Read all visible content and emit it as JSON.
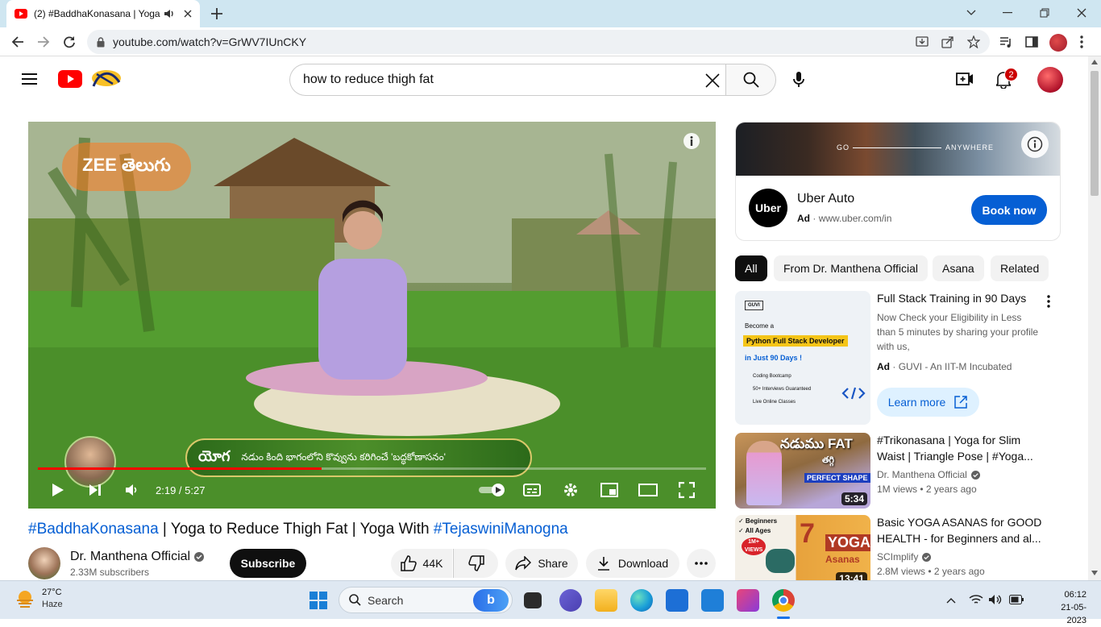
{
  "browser": {
    "tab_title": "(2) #BaddhaKonasana | Yoga",
    "url": "youtube.com/watch?v=GrWV7IUnCKY"
  },
  "youtube": {
    "search_query": "how to reduce thigh fat",
    "notification_count": "2"
  },
  "video": {
    "watermark": "ZEE తెలుగు",
    "caption_tag": "యోగ",
    "caption_text": "నడుం కింది భాగంలోని కొవ్వును కరిగించే 'బద్ధకోణాసనం'",
    "time": "2:19 / 5:27",
    "progress": 0.425,
    "title_prefix": "#BaddhaKonasana",
    "title_middle": " | Yoga to Reduce Thigh Fat | Yoga With ",
    "title_suffix": "#TejaswiniManogna",
    "channel_name": "Dr. Manthena Official",
    "subscribers": "2.33M subscribers",
    "subscribe_label": "Subscribe",
    "likes": "44K",
    "share_label": "Share",
    "download_label": "Download"
  },
  "ad_banner": {
    "overlay_left": "GO",
    "overlay_right": "ANYWHERE",
    "logo_text": "Uber",
    "title": "Uber Auto",
    "ad_label": "Ad",
    "url": "www.uber.com/in",
    "cta": "Book now"
  },
  "chips": [
    "All",
    "From Dr. Manthena Official",
    "Asana",
    "Related"
  ],
  "sidebar_ad": {
    "title": "Full Stack Training in 90 Days",
    "desc": "Now Check your Eligibility in Less than 5 minutes by sharing your profile with us,",
    "ad_label": "Ad",
    "advertiser": "GUVI - An IIT-M Incubated",
    "cta": "Learn more",
    "thumb": {
      "brand": "GUVI",
      "line1": "Become a",
      "highlight": "Python Full Stack Developer",
      "line2": "in Just 90 Days !",
      "bullets": [
        "Coding Bootcamp",
        "50+ Interviews Guaranteed",
        "Live Online Classes"
      ]
    }
  },
  "recommendations": [
    {
      "title": "#Trikonasana | Yoga for Slim Waist | Triangle Pose | #Yoga...",
      "channel": "Dr. Manthena Official",
      "views": "1M views",
      "age": "2 years ago",
      "duration": "5:34",
      "thumb_top": "నడుము FAT",
      "thumb_mid": "తగ్గి",
      "thumb_band": "PERFECT SHAPE"
    },
    {
      "title": "Basic YOGA ASANAS for GOOD HEALTH - for Beginners and al...",
      "channel": "SCImplify",
      "views": "2.8M views",
      "age": "2 years ago",
      "duration": "13:41",
      "thumb_check1": "✓ Beginners",
      "thumb_check2": "✓ All Ages",
      "thumb_badge": "1M+ VIEWS",
      "thumb_num": "7",
      "thumb_word": "YOGA",
      "thumb_word2": "Asanas"
    }
  ],
  "taskbar": {
    "temperature": "27°C",
    "weather": "Haze",
    "search_label": "Search",
    "time": "06:12",
    "date": "21-05-2023"
  }
}
